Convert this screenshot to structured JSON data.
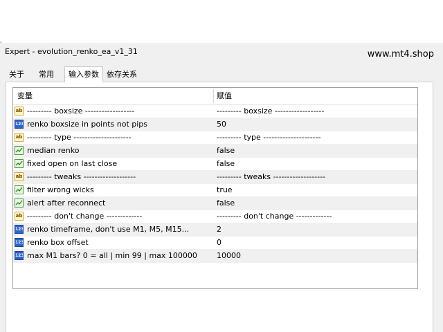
{
  "window": {
    "title": "Expert - evolution_renko_ea_v1_31"
  },
  "watermark": "www.mt4.shop",
  "tabs": [
    {
      "label": "关于"
    },
    {
      "label": "常用"
    },
    {
      "label": "输入参数"
    },
    {
      "label": "依存关系"
    }
  ],
  "table": {
    "columns": [
      "变量",
      "赋值"
    ],
    "rows": [
      {
        "type": "string",
        "name": "--------- boxsize ------------------",
        "value": "--------- boxsize ------------------"
      },
      {
        "type": "int",
        "name": "renko boxsize in points not pips",
        "value": "50"
      },
      {
        "type": "string",
        "name": "--------- type ---------------------",
        "value": "--------- type ---------------------"
      },
      {
        "type": "bool",
        "name": "median renko",
        "value": "false"
      },
      {
        "type": "bool",
        "name": "fixed open on last close",
        "value": "false"
      },
      {
        "type": "string",
        "name": "--------- tweaks -------------------",
        "value": "--------- tweaks -------------------"
      },
      {
        "type": "bool",
        "name": "filter wrong wicks",
        "value": "true"
      },
      {
        "type": "bool",
        "name": "alert after reconnect",
        "value": "false"
      },
      {
        "type": "string",
        "name": "--------- don't change -------------",
        "value": "--------- don't change -------------"
      },
      {
        "type": "int",
        "name": "renko timeframe, don't use M1, M5, M15...",
        "value": "2"
      },
      {
        "type": "int",
        "name": "renko box offset",
        "value": "0"
      },
      {
        "type": "int",
        "name": "max M1 bars? 0 = all | min 99 | max 100000",
        "value": "10000"
      }
    ]
  },
  "icons": {
    "string": {
      "name": "string-type-icon",
      "glyph": "ab"
    },
    "int": {
      "name": "integer-type-icon",
      "glyph": "123"
    },
    "bool": {
      "name": "boolean-type-icon",
      "glyph": ""
    }
  }
}
